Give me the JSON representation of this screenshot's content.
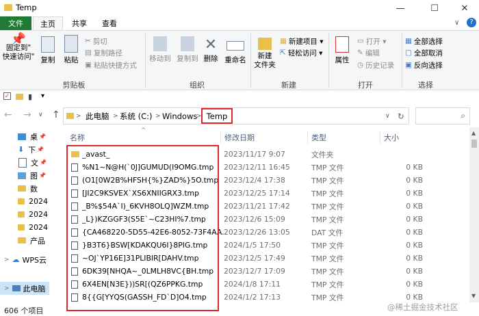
{
  "window": {
    "title": "Temp",
    "minimize": "—",
    "maximize": "☐",
    "close": "✕"
  },
  "tabs": {
    "file": "文件",
    "home": "主页",
    "share": "共享",
    "view": "查看"
  },
  "ribbon": {
    "clipboard": {
      "pin": "固定到\"\n快速访问\"",
      "pin_l1": "固定到\"",
      "pin_l2": "快速访问\"",
      "copy": "复制",
      "paste": "粘贴",
      "cut": "剪切",
      "copy_path": "复制路径",
      "paste_shortcut": "粘贴快捷方式",
      "group": "剪贴板"
    },
    "organize": {
      "move_to": "移动到",
      "copy_to": "复制到",
      "delete": "删除",
      "rename": "重命名",
      "group": "组织"
    },
    "new": {
      "new_folder_l1": "新建",
      "new_folder_l2": "文件夹",
      "new_item": "新建项目 ▾",
      "easy_access": "轻松访问 ▾",
      "group": "新建"
    },
    "open": {
      "properties": "属性",
      "open": "打开 ▾",
      "edit": "编辑",
      "history": "历史记录",
      "group": "打开"
    },
    "select": {
      "select_all": "全部选择",
      "select_none": "全部取消",
      "invert": "反向选择",
      "group": "选择"
    }
  },
  "address": {
    "pc": "此电脑",
    "drive": "系统 (C:)",
    "folder1": "Windows",
    "current": "Temp"
  },
  "nav": [
    {
      "label": "桌"
    },
    {
      "label": "下"
    },
    {
      "label": "文"
    },
    {
      "label": "图"
    },
    {
      "label": "数"
    },
    {
      "label": "2024"
    },
    {
      "label": "2024"
    },
    {
      "label": "2024"
    },
    {
      "label": "产品"
    },
    {
      "label": "WPS云"
    },
    {
      "label": "此电脑"
    }
  ],
  "columns": {
    "name": "名称",
    "date": "修改日期",
    "type": "类型",
    "size": "大小"
  },
  "files": [
    {
      "name": "_avast_",
      "date": "2023/11/17 9:07",
      "type": "文件夹",
      "size": "",
      "kind": "folder"
    },
    {
      "name": "%N1~N@H(`0J]GUMUD(I9OMG.tmp",
      "date": "2023/12/11 16:45",
      "type": "TMP 文件",
      "size": "0 KB",
      "kind": "file"
    },
    {
      "name": "(O1[0W2B%HFSH{%}ZAD%}5O.tmp",
      "date": "2023/12/4 17:38",
      "type": "TMP 文件",
      "size": "0 KB",
      "kind": "file"
    },
    {
      "name": "[JI2C9KSVEX`XS6XNIIGRX3.tmp",
      "date": "2023/12/25 17:14",
      "type": "TMP 文件",
      "size": "0 KB",
      "kind": "file"
    },
    {
      "name": "_B%$54A`I)_6KVH8OLQ]WZM.tmp",
      "date": "2023/11/21 17:42",
      "type": "TMP 文件",
      "size": "0 KB",
      "kind": "file"
    },
    {
      "name": "_L})KZGGF3(S5E`~C23HI%7.tmp",
      "date": "2023/12/6 15:09",
      "type": "TMP 文件",
      "size": "0 KB",
      "kind": "file"
    },
    {
      "name": "{CA468220-5D55-42E6-8052-73F4AA...",
      "date": "2023/12/26 13:05",
      "type": "DAT 文件",
      "size": "0 KB",
      "kind": "file"
    },
    {
      "name": "}B3T6}BSW[KDAKQU6I}8PIG.tmp",
      "date": "2024/1/5 17:50",
      "type": "TMP 文件",
      "size": "0 KB",
      "kind": "file"
    },
    {
      "name": "~OJ`YP16E]31PLIBIR[DAHV.tmp",
      "date": "2023/12/5 17:49",
      "type": "TMP 文件",
      "size": "0 KB",
      "kind": "file"
    },
    {
      "name": "6DK39[NHQA~_0LMLH8VC{BH.tmp",
      "date": "2023/12/7 17:09",
      "type": "TMP 文件",
      "size": "0 KB",
      "kind": "file"
    },
    {
      "name": "6X4EN[N3E}))SR[(QZ6PPKG.tmp",
      "date": "2024/1/8 17:11",
      "type": "TMP 文件",
      "size": "0 KB",
      "kind": "file"
    },
    {
      "name": "8{{G[YYQS(GASSH_FD`D]O4.tmp",
      "date": "2024/1/2 17:13",
      "type": "TMP 文件",
      "size": "0 KB",
      "kind": "file"
    }
  ],
  "status": {
    "count": "606 个项目"
  },
  "watermark": "@稀土掘金技术社区",
  "colors": {
    "highlight": "#e0262b",
    "file_tab": "#1f7a34",
    "folder": "#e8c14d"
  }
}
